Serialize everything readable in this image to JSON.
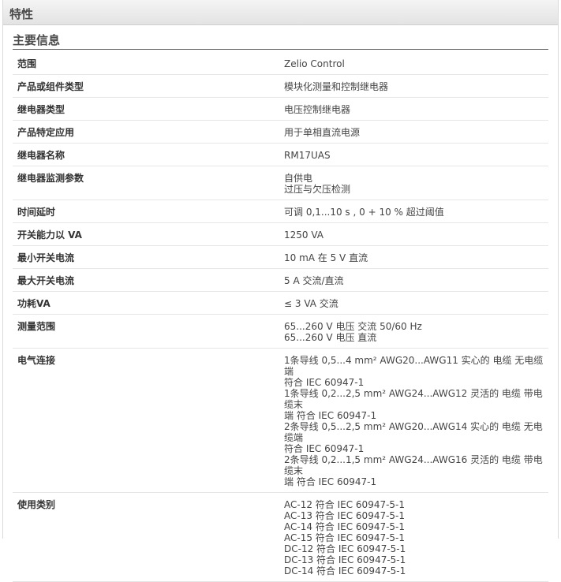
{
  "header": {
    "title": "特性"
  },
  "section": {
    "title": "主要信息"
  },
  "rows": [
    {
      "label": "范围",
      "value": "Zelio Control"
    },
    {
      "label": "产品或组件类型",
      "value": "模块化测量和控制继电器"
    },
    {
      "label": "继电器类型",
      "value": "电压控制继电器"
    },
    {
      "label": "产品特定应用",
      "value": "用于单相直流电源"
    },
    {
      "label": "继电器名称",
      "value": "RM17UAS"
    },
    {
      "label": "继电器监测参数",
      "value": "自供电\n过压与欠压检测"
    },
    {
      "label": "时间延时",
      "value": "可调 0,1...10 s , 0 + 10 % 超过阈值"
    },
    {
      "label": "开关能力以 VA",
      "value": "1250 VA"
    },
    {
      "label": "最小开关电流",
      "value": "10 mA 在 5 V 直流"
    },
    {
      "label": "最大开关电流",
      "value": "5 A 交流/直流"
    },
    {
      "label": "功耗VA",
      "value": "≤ 3 VA 交流"
    },
    {
      "label": "测量范围",
      "value": "65...260 V 电压 交流 50/60 Hz\n65...260 V 电压 直流"
    },
    {
      "label": "电气连接",
      "value": "1条导线 0,5...4 mm² AWG20...AWG11 实心的 电缆 无电缆端\n符合 IEC 60947-1\n1条导线 0,2...2,5 mm² AWG24...AWG12 灵活的 电缆 带电缆末\n端 符合 IEC 60947-1\n2条导线 0,5...2,5 mm² AWG20...AWG14 实心的 电缆 无电缆端\n符合 IEC 60947-1\n2条导线 0,2...1,5 mm² AWG24...AWG16 灵活的 电缆 带电缆末\n端 符合 IEC 60947-1"
    },
    {
      "label": "使用类别",
      "value": "AC-12 符合 IEC 60947-5-1\nAC-13 符合 IEC 60947-5-1\nAC-14 符合 IEC 60947-5-1\nAC-15 符合 IEC 60947-5-1\nDC-12 符合 IEC 60947-5-1\nDC-13 符合 IEC 60947-5-1\nDC-14 符合 IEC 60947-5-1"
    }
  ]
}
